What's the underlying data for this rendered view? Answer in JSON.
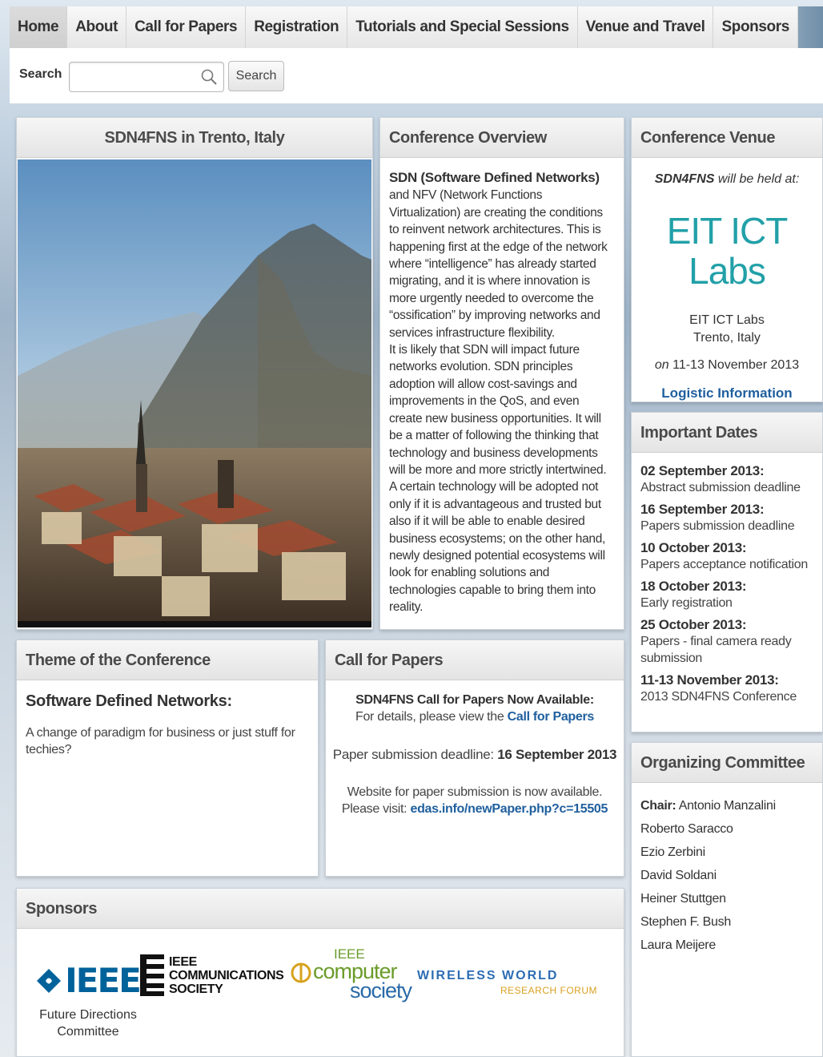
{
  "nav": {
    "items": [
      {
        "label": "Home"
      },
      {
        "label": "About"
      },
      {
        "label": "Call for Papers"
      },
      {
        "label": "Registration"
      },
      {
        "label": "Tutorials and Special Sessions"
      },
      {
        "label": "Venue and Travel"
      },
      {
        "label": "Sponsors"
      }
    ]
  },
  "search": {
    "label": "Search",
    "value": "",
    "button_label": "Search",
    "icon": "search-icon"
  },
  "hero": {
    "title": "SDN4FNS in Trento, Italy",
    "image_description_icon": "photo"
  },
  "overview": {
    "title": "Conference Overview",
    "bold_lead": "SDN (Software Defined Networks)",
    "text_1": " and NFV (Network Functions Virtualization) are creating the conditions to reinvent network architectures. This is happening first at the edge of the network where “intelligence” has already started migrating, and it is where innovation is more urgently needed to overcome the “ossification” by improving networks and services infrastructure flexibility.",
    "text_2": "It is likely that SDN will impact future networks evolution. SDN principles adoption will allow cost-savings and improvements in the QoS, and even create new business opportunities. It will be a matter of following the thinking that technology and business developments will be more and more strictly intertwined. A certain technology will be adopted not only if it is advantageous and trusted but also if it will be able to enable desired business ecosystems; on the other hand, newly designed potential ecosystems will look for enabling solutions and technologies capable to bring them into reality."
  },
  "venue": {
    "title": "Conference Venue",
    "intro_bold": "SDN4FNS",
    "intro_rest": " will be held at:",
    "logo_text": "EIT ICT Labs",
    "name": "EIT ICT Labs",
    "city": "Trento, Italy",
    "date_prefix": "on",
    "date": " 11-13 November 2013",
    "link": "Logistic Information"
  },
  "dates": {
    "title": "Important Dates",
    "entries": [
      {
        "date": "02 September 2013:",
        "desc": "Abstract submission deadline"
      },
      {
        "date": "16 September 2013:",
        "desc": "Papers submission deadline"
      },
      {
        "date": "10 October 2013:",
        "desc": "Papers acceptance notification"
      },
      {
        "date": "18 October 2013:",
        "desc": "Early registration"
      },
      {
        "date": "25 October 2013:",
        "desc": "Papers - final camera ready submission"
      },
      {
        "date": "11-13 November 2013:",
        "desc": "2013 SDN4FNS Conference"
      }
    ]
  },
  "committee": {
    "title": "Organizing Committee",
    "chair_label": "Chair:",
    "chair_name": " Antonio Manzalini",
    "members": [
      "Roberto Saracco",
      "Ezio Zerbini",
      "David Soldani",
      "Heiner Stuttgen",
      "Stephen F. Bush",
      "Laura Meijere"
    ]
  },
  "theme": {
    "title": "Theme of the Conference",
    "subtitle": "Software Defined Networks:",
    "text": "A change of paradigm for business or just stuff for techies?"
  },
  "cfp": {
    "title": "Call for Papers",
    "headline": "SDN4FNS Call for Papers Now Available:",
    "details_prefix": "For details, please view the ",
    "details_link": "Call for Papers",
    "deadline_prefix": "Paper submission deadline: ",
    "deadline": "16 September 2013",
    "website_line": "Website for paper submission is now available.",
    "visit_prefix": "Please visit: ",
    "visit_link": "edas.info/newPaper.php?c=15505"
  },
  "sponsors": {
    "title": "Sponsors",
    "ieee": "IEEE",
    "ieee_sub": "Future Directions Committee",
    "comsoc_1": "IEEE",
    "comsoc_2": "COMMUNICATIONS",
    "comsoc_3": "SOCIETY",
    "cs_ieee": "IEEE",
    "cs_computer": "computer",
    "cs_society": "society",
    "wwrf_1": "WIRELESS",
    "wwrf_2": "WORLD",
    "wwrf_3": "RESEARCH FORUM"
  },
  "colors": {
    "link": "#1f5f9e",
    "eit_teal": "#22a0a8",
    "ieee_blue": "#00629b"
  }
}
